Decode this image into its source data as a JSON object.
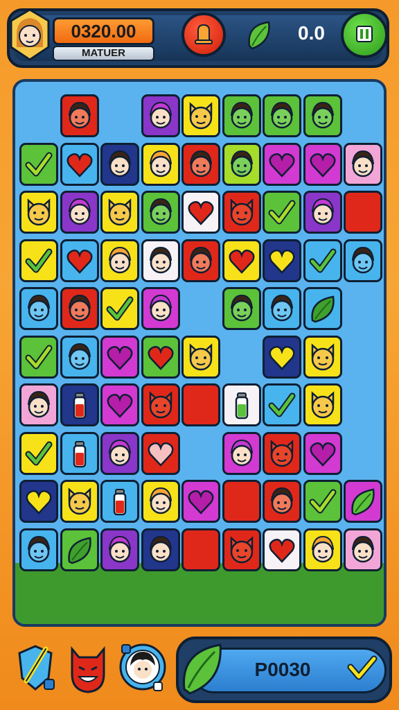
{
  "hud": {
    "score": "0320.00",
    "rank_label": "MATUER",
    "timer": "0.0",
    "bell_icon": "bell-icon",
    "leaf_icon": "leaf-icon",
    "pause_icon": "pause-icon"
  },
  "board": {
    "columns": 9,
    "rows": 10,
    "cells": [
      [
        "",
        "face-red",
        "",
        "face-purple",
        "cat-yellow",
        "face-green",
        "face-green",
        "face-green",
        ""
      ],
      [
        "check-green",
        "heart-blue",
        "face-navy",
        "face-yellow",
        "face-red",
        "face-lime",
        "heart-magenta",
        "heart-magenta",
        "face-pink"
      ],
      [
        "cat-yellow",
        "face-purple",
        "cat-yellow",
        "face-green",
        "heart-white",
        "cat-red",
        "check-green",
        "face-purple",
        "blank-red"
      ],
      [
        "check-yellow",
        "heart-blue",
        "face-yellow",
        "face-white",
        "face-red",
        "heart-yellow",
        "heart-navy",
        "check-blue",
        "face-blue"
      ],
      [
        "face-blue",
        "face-red",
        "check-yellow",
        "face-magenta",
        "",
        "face-green",
        "face-blue",
        "leaf-blue",
        ""
      ],
      [
        "check-green",
        "face-blue",
        "heart-magenta",
        "heart-green",
        "cat-yellow",
        "",
        "heart-navy",
        "cat-yellow",
        ""
      ],
      [
        "face-pink",
        "bottle-navy",
        "heart-magenta",
        "cat-red",
        "blank-red",
        "bottle-white",
        "check-blue",
        "cat-yellow",
        ""
      ],
      [
        "check-yellow",
        "bottle-blue",
        "face-purple",
        "heart-red",
        "",
        "face-magenta",
        "cat-red",
        "heart-magenta",
        ""
      ],
      [
        "heart-navy",
        "cat-yellow",
        "bottle-blue",
        "face-yellow",
        "heart-magenta",
        "blank-red",
        "face-red",
        "check-green",
        "leaf-magenta"
      ],
      [
        "face-blue",
        "leaf-green",
        "face-purple",
        "face-navy",
        "blank-red",
        "cat-red",
        "heart-white",
        "face-yellow",
        "face-pink"
      ]
    ]
  },
  "bottom": {
    "code": "P0030",
    "tools": [
      "sword-icon",
      "devil-icon",
      "avatar-badge-icon"
    ],
    "leaf_icon": "leaf-icon",
    "heart_icon": "heart-icon"
  },
  "colors": {
    "red": "#e0281a",
    "yellow": "#f7e21a",
    "green": "#5cc23a",
    "lime": "#a6dc2a",
    "blue": "#48b4ee",
    "navy": "#22368c",
    "magenta": "#d23ad2",
    "purple": "#8a36c8",
    "white": "#f6f2f6",
    "pink": "#f2a6d8"
  }
}
